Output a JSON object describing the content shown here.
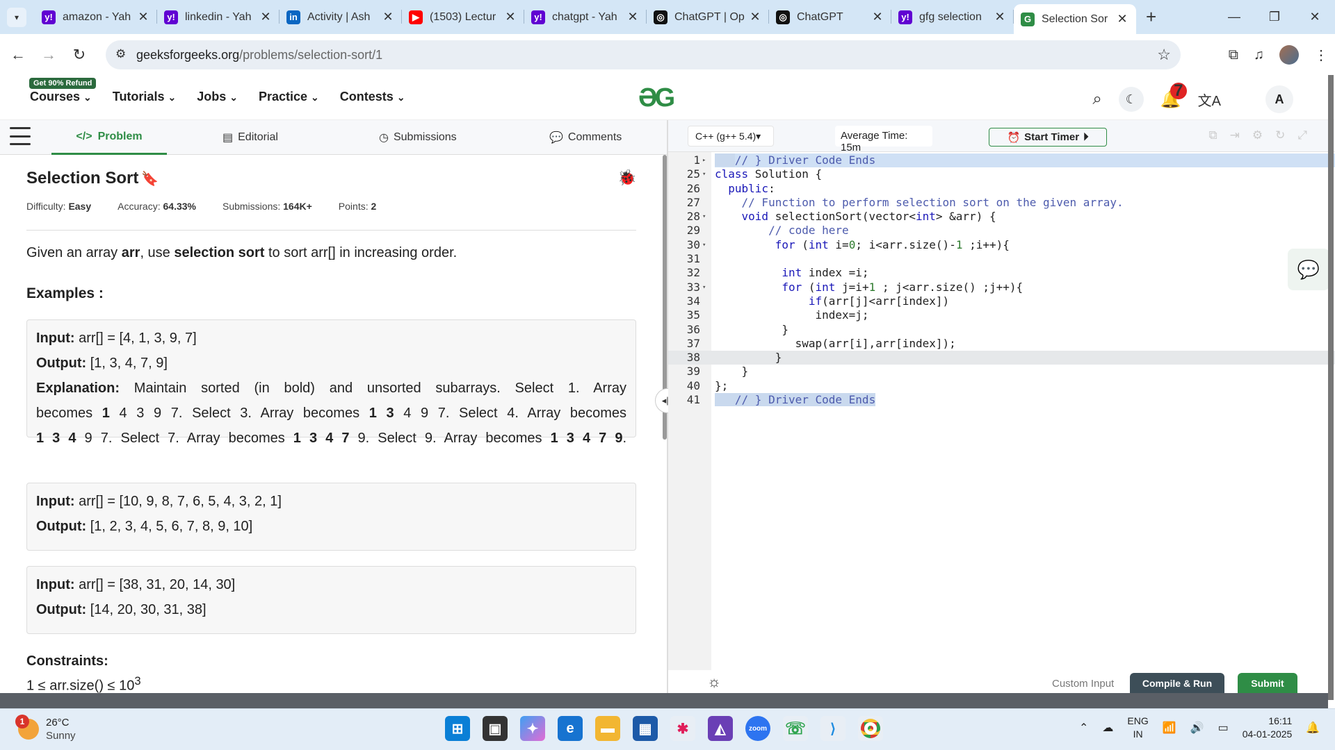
{
  "browser": {
    "tabs": [
      {
        "label": "amazon - Yah",
        "icon": "yahoo-icon",
        "color": "#6001d2"
      },
      {
        "label": "linkedin - Yah",
        "icon": "yahoo-icon",
        "color": "#6001d2"
      },
      {
        "label": "Activity | Ash",
        "icon": "linkedin-icon",
        "color": "#0a66c2"
      },
      {
        "label": "(1503) Lectur",
        "icon": "youtube-icon",
        "color": "#ff0000"
      },
      {
        "label": "chatgpt - Yah",
        "icon": "yahoo-icon",
        "color": "#6001d2"
      },
      {
        "label": "ChatGPT | Op",
        "icon": "openai-icon",
        "color": "#111111"
      },
      {
        "label": "ChatGPT",
        "icon": "openai-icon",
        "color": "#111111"
      },
      {
        "label": "gfg selection",
        "icon": "yahoo-icon",
        "color": "#6001d2"
      },
      {
        "label": "Selection Sor",
        "icon": "gfg-icon",
        "color": "#2f8d46"
      }
    ],
    "url_host": "geeksforgeeks.org",
    "url_path": "/problems/selection-sort/1"
  },
  "gfg_nav": {
    "refund_badge": "Get 90% Refund",
    "items": [
      "Courses",
      "Tutorials",
      "Jobs",
      "Practice",
      "Contests"
    ],
    "notification_count": "7",
    "user_initial": "A"
  },
  "problem_tabs": [
    "Problem",
    "Editorial",
    "Submissions",
    "Comments"
  ],
  "problem": {
    "title": "Selection Sort",
    "difficulty_label": "Difficulty:",
    "difficulty": "Easy",
    "accuracy_label": "Accuracy:",
    "accuracy": "64.33%",
    "submissions_label": "Submissions:",
    "submissions": "164K+",
    "points_label": "Points:",
    "points": "2",
    "desc_1": "Given an array ",
    "desc_arr": "arr",
    "desc_2": ", use ",
    "desc_sel": "selection sort",
    "desc_3": " to sort arr[] in increasing order.",
    "examples_heading": "Examples :",
    "input_label": "Input:",
    "output_label": "Output:",
    "explanation_label": "Explanation:",
    "ex1_input": "arr[] = [4, 1, 3, 9, 7]",
    "ex1_output": "[1, 3, 4, 7, 9]",
    "ex1_exp_line1": "Maintain sorted (in bold) and unsorted subarrays. Select 1. Array",
    "ex1_exp_line2a": "becomes ",
    "ex1_exp_line2b": "1",
    "ex1_exp_line2c": " 4 3 9 7. Select 3. Array becomes ",
    "ex1_exp_line2d": "1 3",
    "ex1_exp_line2e": " 4 9 7. Select 4. Array becomes",
    "ex1_exp_line3a": "1 3 4",
    "ex1_exp_line3b": " 9 7. Select 7. Array becomes ",
    "ex1_exp_line3c": "1 3 4 7",
    "ex1_exp_line3d": " 9. Select 9. Array becomes ",
    "ex1_exp_line3e": "1 3 4 7 9",
    "ex1_exp_line3f": ".",
    "ex2_input": "arr[] = [10, 9, 8, 7, 6, 5, 4, 3, 2, 1]",
    "ex2_output": "[1, 2, 3, 4, 5, 6, 7, 8, 9, 10]",
    "ex3_input": "arr[] = [38, 31, 20, 14, 30]",
    "ex3_output": "[14, 20, 30, 31, 38]",
    "constraints_heading": "Constraints:",
    "constraint_1": "1 ≤ arr.size() ≤ 10",
    "constraint_1_exp": "3"
  },
  "editor": {
    "language": "C++ (g++ 5.4)",
    "avg_time": "Average Time: 15m",
    "timer_label": "Start Timer",
    "custom_input": "Custom Input",
    "compile_run": "Compile & Run",
    "submit": "Submit",
    "lines": [
      {
        "n": "1",
        "fold": "▸",
        "html": "<span class='sel'>&nbsp;&nbsp;&nbsp;</span><span class='cm'>// } Driver Code Ends</span>",
        "hl": "sel"
      },
      {
        "n": "25",
        "fold": "▾",
        "html": "<span class='kw'>class</span> Solution {"
      },
      {
        "n": "26",
        "fold": "",
        "html": "  <span class='kw'>public</span>:"
      },
      {
        "n": "27",
        "fold": "",
        "html": "    <span class='cm'>// Function to perform selection sort on the given array.</span>"
      },
      {
        "n": "28",
        "fold": "▾",
        "html": "    <span class='kw'>void</span> selectionSort(vector&lt;<span class='kw'>int</span>&gt; &amp;arr) {"
      },
      {
        "n": "29",
        "fold": "",
        "html": "        <span class='cm'>// code here</span>"
      },
      {
        "n": "30",
        "fold": "▾",
        "html": "         <span class='kw'>for</span> (<span class='kw'>int</span> i=<span class='num'>0</span>; i&lt;arr.size()-<span class='num'>1</span> ;i++){"
      },
      {
        "n": "31",
        "fold": "",
        "html": ""
      },
      {
        "n": "32",
        "fold": "",
        "html": "          <span class='kw'>int</span> index =i;"
      },
      {
        "n": "33",
        "fold": "▾",
        "html": "          <span class='kw'>for</span> (<span class='kw'>int</span> j=i+<span class='num'>1</span> ; j&lt;arr.size() ;j++){"
      },
      {
        "n": "34",
        "fold": "",
        "html": "              <span class='kw'>if</span>(arr[j]&lt;arr[index])"
      },
      {
        "n": "35",
        "fold": "",
        "html": "               index=j;"
      },
      {
        "n": "36",
        "fold": "",
        "html": "          }"
      },
      {
        "n": "37",
        "fold": "",
        "html": "            swap(arr[i],arr[index]);"
      },
      {
        "n": "38",
        "fold": "",
        "html": "         }",
        "hl": "cur"
      },
      {
        "n": "39",
        "fold": "",
        "html": "    }"
      },
      {
        "n": "40",
        "fold": "",
        "html": "};"
      },
      {
        "n": "41",
        "fold": "",
        "html": "<span class='sel'>&nbsp;&nbsp;&nbsp;<span class='cm'>// } Driver Code Ends</span></span>"
      }
    ]
  },
  "taskbar": {
    "temp": "26°C",
    "weather": "Sunny",
    "weather_badge": "1",
    "lang_1": "ENG",
    "lang_2": "IN",
    "time": "16:11",
    "date": "04-01-2025"
  }
}
